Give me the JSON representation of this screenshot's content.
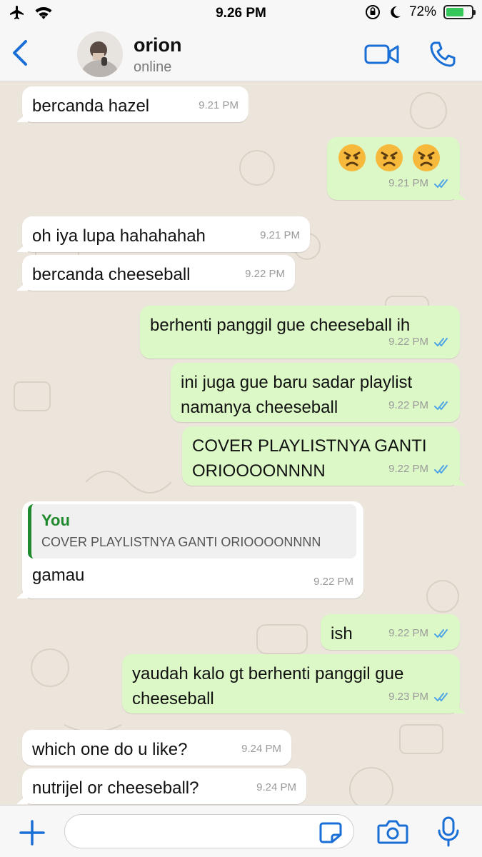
{
  "status_bar": {
    "time": "9.26 PM",
    "battery": "72%",
    "battery_level": 0.72
  },
  "header": {
    "name": "orion",
    "status": "online"
  },
  "messages": [
    {
      "dir": "in",
      "text": "bercanda hazel",
      "time": "9.21 PM"
    },
    {
      "dir": "out",
      "emoji": [
        "angry-face",
        "angry-face",
        "angry-face"
      ],
      "time": "9.21 PM"
    },
    {
      "dir": "in",
      "text": "oh iya lupa hahahahah",
      "time": "9.21 PM"
    },
    {
      "dir": "in",
      "text": "bercanda cheeseball",
      "time": "9.22 PM"
    },
    {
      "dir": "out",
      "text": "berhenti panggil gue cheeseball ih",
      "time": "9.22 PM"
    },
    {
      "dir": "out",
      "lines": [
        "ini juga gue baru sadar playlist",
        "namanya cheeseball"
      ],
      "time": "9.22 PM"
    },
    {
      "dir": "out",
      "lines": [
        "COVER PLAYLISTNYA GANTI",
        "ORIOOOONNNN"
      ],
      "time": "9.22 PM"
    },
    {
      "dir": "in",
      "quote_author": "You",
      "quote_text": "COVER PLAYLISTNYA GANTI ORIOOOONNNN",
      "text": "gamau",
      "time": "9.22 PM"
    },
    {
      "dir": "out",
      "text": "ish",
      "time": "9.22 PM"
    },
    {
      "dir": "out",
      "lines": [
        "yaudah kalo gt berhenti panggil gue",
        "cheeseball"
      ],
      "time": "9.23 PM"
    },
    {
      "dir": "in",
      "text": "which one do u like?",
      "time": "9.24 PM"
    },
    {
      "dir": "in",
      "text": "nutrijel or cheeseball?",
      "time": "9.24 PM"
    }
  ],
  "input": {
    "placeholder": ""
  },
  "colors": {
    "accent": "#1a6fd6",
    "outgoing": "#dcf8c6",
    "incoming": "#ffffff",
    "quote_accent": "#1f8a2d",
    "read_check": "#4fa5e6"
  }
}
